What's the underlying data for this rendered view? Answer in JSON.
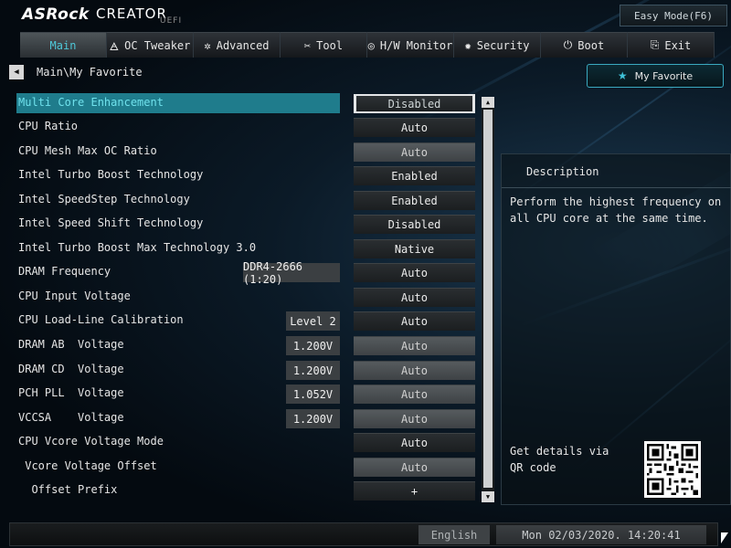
{
  "brand": {
    "logo": "ASRock",
    "product": "CREATOR",
    "suffix": "UEFI"
  },
  "easy_mode": "Easy Mode(F6)",
  "tabs": [
    {
      "label": "Main",
      "icon": ""
    },
    {
      "label": "OC Tweaker",
      "icon": "🜁"
    },
    {
      "label": "Advanced",
      "icon": "✲"
    },
    {
      "label": "Tool",
      "icon": "✂"
    },
    {
      "label": "H/W Monitor",
      "icon": "◎"
    },
    {
      "label": "Security",
      "icon": "✹"
    },
    {
      "label": "Boot",
      "icon": "⏻"
    },
    {
      "label": "Exit",
      "icon": "⎘"
    }
  ],
  "breadcrumb": {
    "back_icon": "◀",
    "path": "Main\\My Favorite"
  },
  "favorite": {
    "star": "★",
    "label": "My Favorite"
  },
  "settings": [
    {
      "label": "Multi Core Enhancement",
      "current": "",
      "value": "Disabled"
    },
    {
      "label": "CPU Ratio",
      "current": "",
      "value": "Auto"
    },
    {
      "label": "CPU Mesh Max OC Ratio",
      "current": "",
      "value": "Auto"
    },
    {
      "label": "Intel Turbo Boost Technology",
      "current": "",
      "value": "Enabled"
    },
    {
      "label": "Intel SpeedStep Technology",
      "current": "",
      "value": "Enabled"
    },
    {
      "label": "Intel Speed Shift Technology",
      "current": "",
      "value": "Disabled"
    },
    {
      "label": "Intel Turbo Boost Max Technology 3.0",
      "current": "",
      "value": "Native"
    },
    {
      "label": "DRAM Frequency",
      "current": "DDR4-2666 (1:20)",
      "value": "Auto"
    },
    {
      "label": "CPU Input Voltage",
      "current": "",
      "value": "Auto"
    },
    {
      "label": "CPU Load-Line Calibration",
      "current": "Level 2",
      "value": "Auto"
    },
    {
      "label": "DRAM AB  Voltage",
      "current": "1.200V",
      "value": "Auto"
    },
    {
      "label": "DRAM CD  Voltage",
      "current": "1.200V",
      "value": "Auto"
    },
    {
      "label": "PCH PLL  Voltage",
      "current": "1.052V",
      "value": "Auto"
    },
    {
      "label": "VCCSA    Voltage",
      "current": "1.200V",
      "value": "Auto"
    },
    {
      "label": "CPU Vcore Voltage Mode",
      "current": "",
      "value": "Auto"
    },
    {
      "label": " Vcore Voltage Offset",
      "current": "",
      "value": "Auto"
    },
    {
      "label": "  Offset Prefix",
      "current": "",
      "value": "+"
    }
  ],
  "scroll": {
    "up": "▲",
    "down": "▼"
  },
  "description": {
    "heading": "Description",
    "text": "Perform the highest frequency on all CPU core at the same time.",
    "qr_label": "Get details via QR code"
  },
  "status": {
    "language": "English",
    "datetime": "Mon 02/03/2020. 14:20:41"
  }
}
